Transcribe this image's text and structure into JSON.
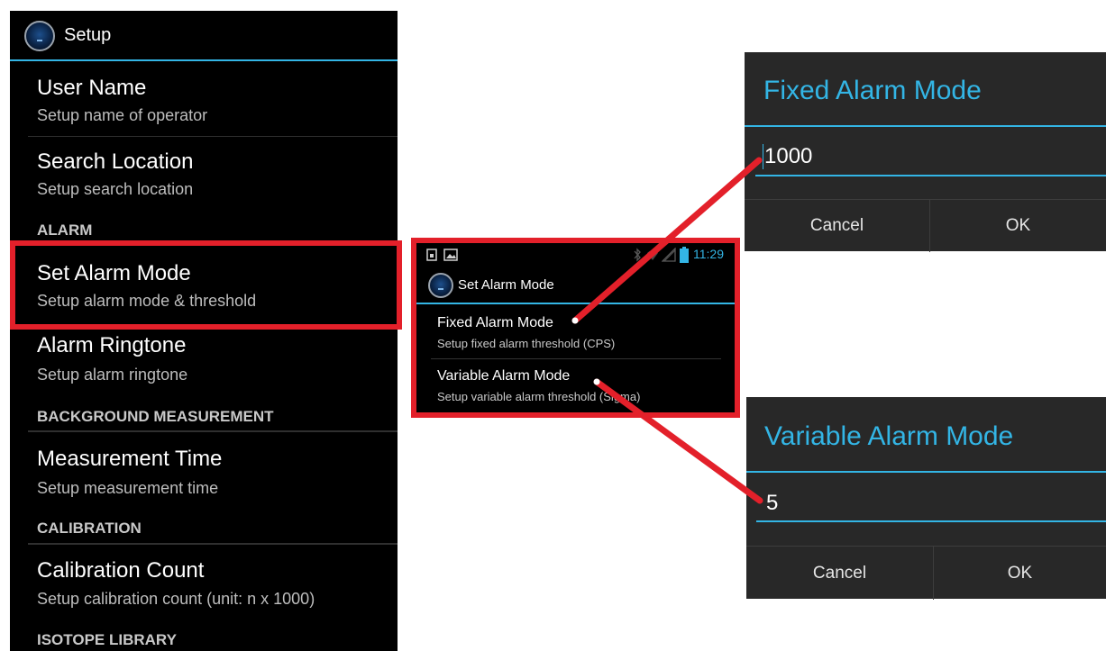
{
  "setup": {
    "title": "Setup",
    "items": [
      {
        "title": "User Name",
        "subtitle": "Setup name of operator"
      },
      {
        "title": "Search Location",
        "subtitle": "Setup search location"
      },
      {
        "title": "Set Alarm Mode",
        "subtitle": "Setup alarm mode & threshold"
      },
      {
        "title": "Alarm Ringtone",
        "subtitle": "Setup alarm ringtone"
      },
      {
        "title": "Measurement Time",
        "subtitle": "Setup measurement time"
      },
      {
        "title": "Calibration Count",
        "subtitle": "Setup calibration count (unit: n x 1000)"
      }
    ],
    "categories": {
      "alarm": "ALARM",
      "background": "BACKGROUND MEASUREMENT",
      "calibration": "CALIBRATION",
      "isotope": "ISOTOPE LIBRARY"
    }
  },
  "phone": {
    "status_time": "11:29",
    "title": "Set Alarm Mode",
    "items": [
      {
        "title": "Fixed Alarm Mode",
        "subtitle": "Setup fixed alarm threshold (CPS)"
      },
      {
        "title": "Variable Alarm Mode",
        "subtitle": "Setup variable alarm threshold (Sigma)"
      }
    ]
  },
  "fixed_dialog": {
    "title": "Fixed Alarm Mode",
    "value": "1000",
    "cancel": "Cancel",
    "ok": "OK"
  },
  "variable_dialog": {
    "title": "Variable Alarm Mode",
    "value": "5",
    "cancel": "Cancel",
    "ok": "OK"
  },
  "colors": {
    "accent": "#33b5e5",
    "highlight": "#e3202a",
    "background": "#000000",
    "dialog": "#282828"
  },
  "icons": [
    "app-icon",
    "sim-icon",
    "image-icon",
    "bluetooth-icon",
    "wifi-icon",
    "signal-icon",
    "battery-icon"
  ]
}
